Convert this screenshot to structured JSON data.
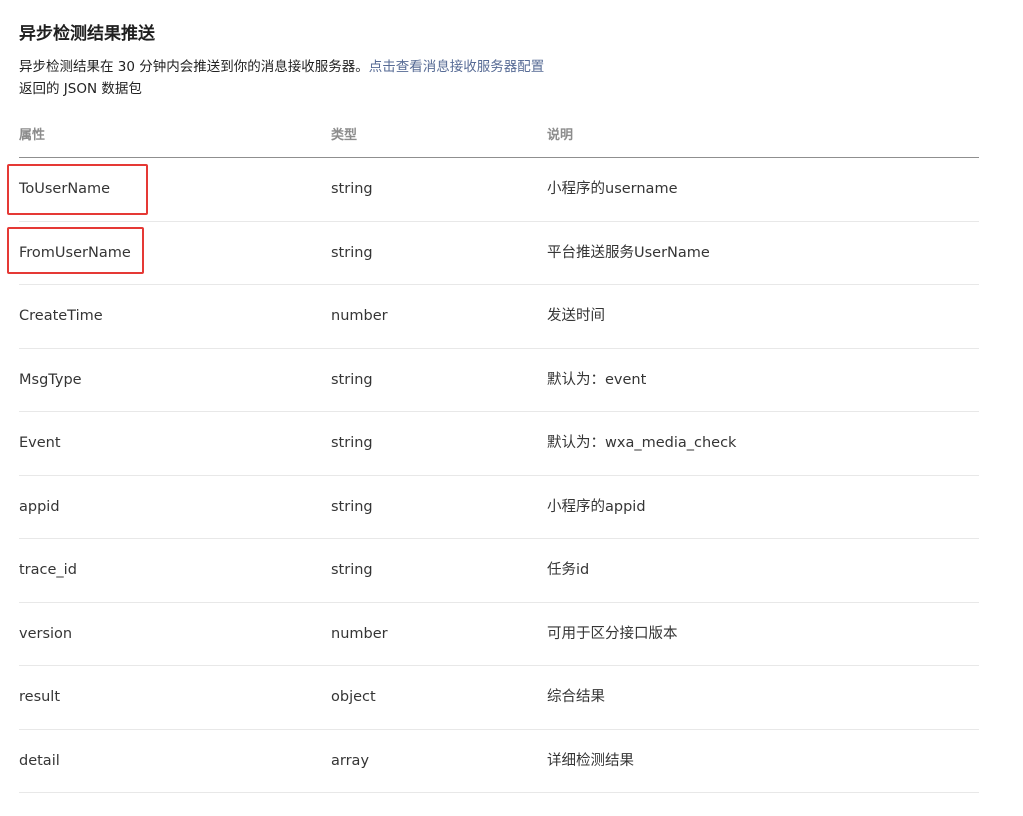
{
  "section": {
    "title": "异步检测结果推送",
    "desc_text": "异步检测结果在 30 分钟内会推送到你的消息接收服务器。",
    "desc_link": "点击查看消息接收服务器配置",
    "desc_line2": "返回的 JSON 数据包"
  },
  "table": {
    "headers": [
      "属性",
      "类型",
      "说明"
    ],
    "rows": [
      [
        "ToUserName",
        "string",
        "小程序的username"
      ],
      [
        "FromUserName",
        "string",
        "平台推送服务UserName"
      ],
      [
        "CreateTime",
        "number",
        "发送时间"
      ],
      [
        "MsgType",
        "string",
        "默认为：event"
      ],
      [
        "Event",
        "string",
        "默认为：wxa_media_check"
      ],
      [
        "appid",
        "string",
        "小程序的appid"
      ],
      [
        "trace_id",
        "string",
        "任务id"
      ],
      [
        "version",
        "number",
        "可用于区分接口版本"
      ],
      [
        "result",
        "object",
        "综合结果"
      ],
      [
        "detail",
        "array",
        "详细检测结果"
      ]
    ]
  },
  "colors": {
    "link": "#576b95",
    "highlight": "#e53935"
  }
}
